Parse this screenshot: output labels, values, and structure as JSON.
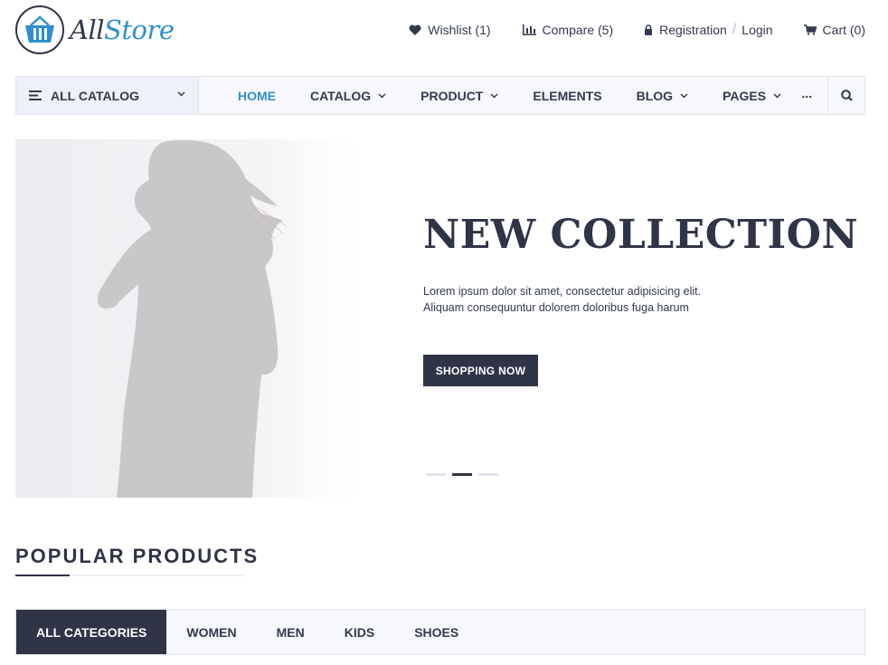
{
  "header": {
    "logo": {
      "prefix": "All",
      "suffix": "Store"
    },
    "links": {
      "wishlist": "Wishlist (1)",
      "compare": "Compare (5)",
      "registration": "Registration",
      "login": "Login",
      "cart": "Cart (0)"
    }
  },
  "nav": {
    "catalog_label": "ALL CATALOG",
    "items": [
      {
        "label": "HOME"
      },
      {
        "label": "CATALOG"
      },
      {
        "label": "PRODUCT"
      },
      {
        "label": "ELEMENTS"
      },
      {
        "label": "BLOG"
      },
      {
        "label": "PAGES"
      }
    ],
    "more": "..."
  },
  "hero": {
    "title": "NEW COLLECTION",
    "text_line1": "Lorem ipsum dolor sit amet, consectetur adipisicing elit.",
    "text_line2": "Aliquam consequuntur dolorem doloribus fuga harum",
    "button": "SHOPPING NOW",
    "slides": 3,
    "active_slide": 2
  },
  "popular": {
    "title": "POPULAR PRODUCTS",
    "tabs": [
      "ALL CATEGORIES",
      "WOMEN",
      "MEN",
      "KIDS",
      "SHOES"
    ],
    "active_tab": 0
  },
  "colors": {
    "accent": "#2e8fd0",
    "dark": "#2f3447",
    "nav_bg": "#f7f8fb"
  }
}
